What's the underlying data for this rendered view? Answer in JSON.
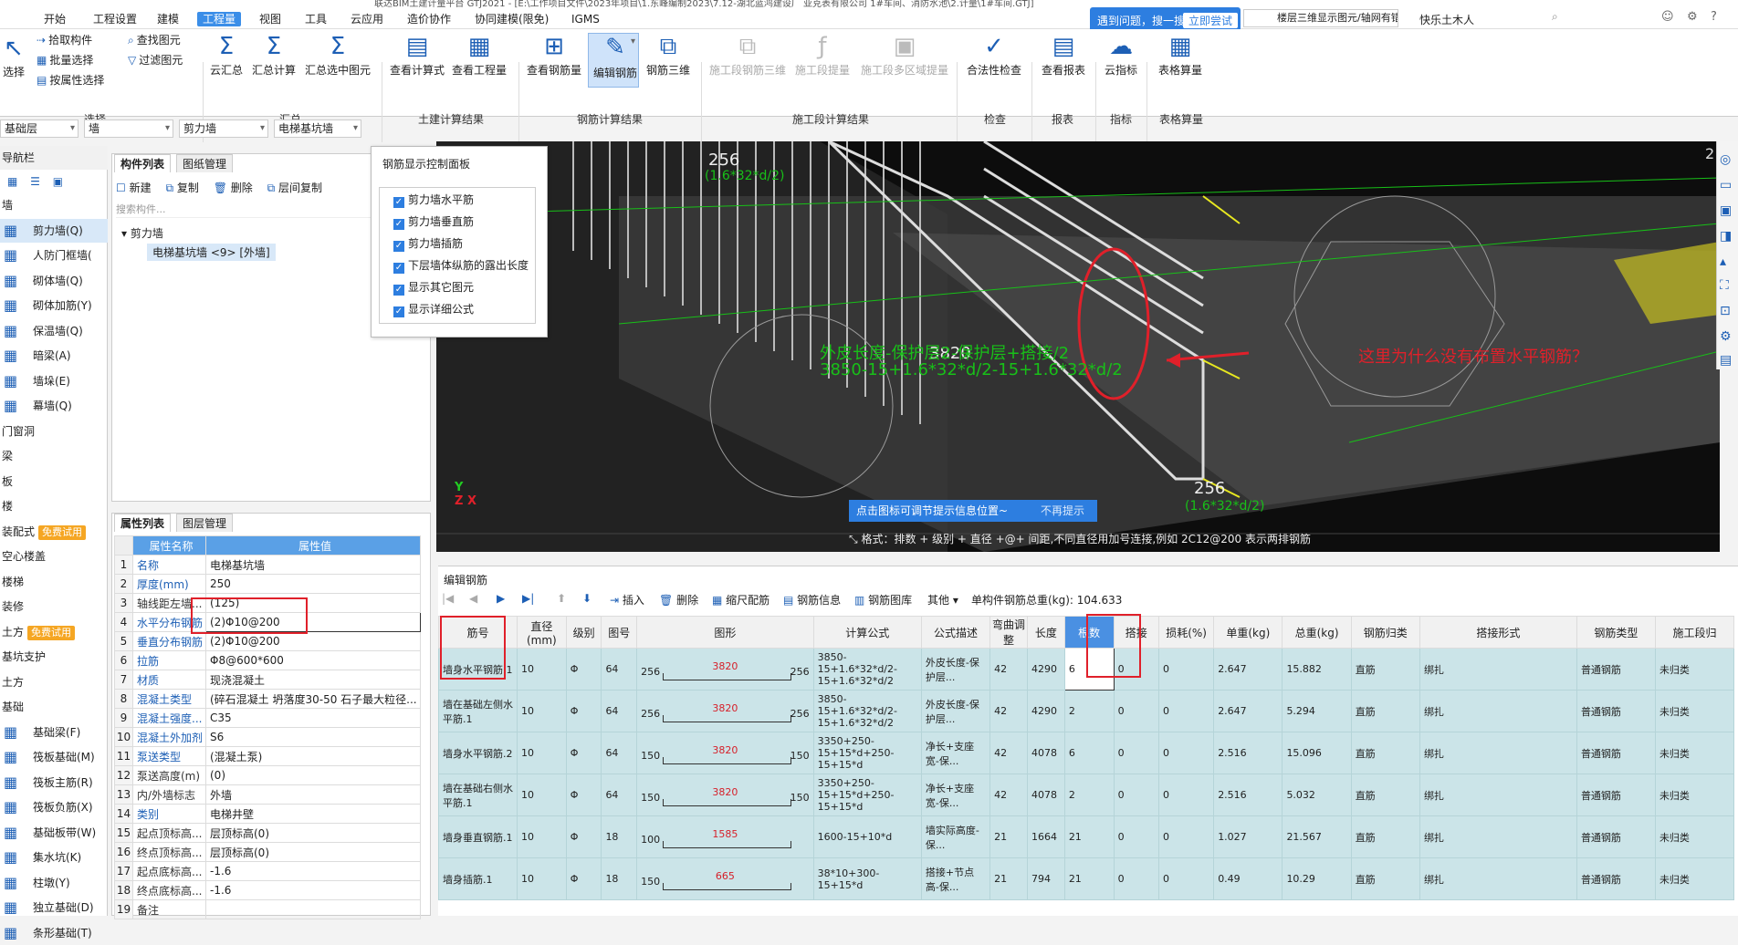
{
  "title": "联达BIM土建计量平台 GTJ2021 - [E:\\工作项目文件\\2023年项目\\1.东峰编制2023\\7.12-湖北蓝鸿建设厂 亚克表有限公司 1#车间、消防水池\\2.计量\\1#车间.GTJ]",
  "menu": [
    "开始",
    "工程设置",
    "建模",
    "工程量",
    "视图",
    "工具",
    "云应用",
    "造价协作",
    "协同建模(限免)",
    "IGMS"
  ],
  "help": {
    "label": "遇到问题，搜一搜",
    "try": "立即尝试",
    "search": "楼层三维显示图元/轴网有错位，位置不对应如何处理?",
    "user": "快乐土木人"
  },
  "ribbon": {
    "select": {
      "big": "选择",
      "items": [
        "拾取构件",
        "批量选择",
        "按属性选择"
      ],
      "group": "选择"
    },
    "summary": {
      "items": [
        "云汇总",
        "汇总计算",
        "汇总选中图元"
      ],
      "small": [
        "查找图元",
        "过滤图元"
      ],
      "group": "汇总"
    },
    "civil": {
      "items": [
        "查看计算式",
        "查看工程量"
      ],
      "group": "土建计算结果"
    },
    "rebar": {
      "items": [
        "查看钢筋量",
        "编辑钢筋",
        "钢筋三维"
      ],
      "group": "钢筋计算结果"
    },
    "stage": {
      "items": [
        "施工段钢筋三维",
        "施工段提量",
        "施工段多区域提量"
      ],
      "group": "施工段计算结果"
    },
    "check": {
      "items": [
        "合法性检查"
      ],
      "group": "检查"
    },
    "report": {
      "items": [
        "查看报表"
      ],
      "group": "报表"
    },
    "index": {
      "items": [
        "云指标"
      ],
      "group": "指标"
    },
    "table": {
      "items": [
        "表格算量"
      ],
      "group": "表格算量"
    }
  },
  "selects": [
    "基础层",
    "墙",
    "剪力墙",
    "电梯基坑墙"
  ],
  "nav": {
    "header": "导航栏",
    "items": [
      {
        "label": "墙"
      },
      {
        "label": "剪力墙(Q)",
        "sub": true,
        "active": true
      },
      {
        "label": "人防门框墙(",
        "sub": true
      },
      {
        "label": "砌体墙(Q)",
        "sub": true
      },
      {
        "label": "砌体加筋(Y)",
        "sub": true
      },
      {
        "label": "保温墙(Q)",
        "sub": true
      },
      {
        "label": "暗梁(A)",
        "sub": true
      },
      {
        "label": "墙垛(E)",
        "sub": true
      },
      {
        "label": "幕墙(Q)",
        "sub": true
      },
      {
        "label": "门窗洞"
      },
      {
        "label": "梁"
      },
      {
        "label": "板"
      },
      {
        "label": "楼"
      },
      {
        "label": "装配式",
        "badge": "免费试用"
      },
      {
        "label": "空心楼盖"
      },
      {
        "label": "楼梯"
      },
      {
        "label": "装修"
      },
      {
        "label": "土方",
        "badge": "免费试用"
      },
      {
        "label": "基坑支护"
      },
      {
        "label": "土方"
      },
      {
        "label": "基础"
      },
      {
        "label": "基础梁(F)",
        "sub": true
      },
      {
        "label": "筏板基础(M)",
        "sub": true
      },
      {
        "label": "筏板主筋(R)",
        "sub": true
      },
      {
        "label": "筏板负筋(X)",
        "sub": true
      },
      {
        "label": "基础板带(W)",
        "sub": true
      },
      {
        "label": "集水坑(K)",
        "sub": true
      },
      {
        "label": "柱墩(Y)",
        "sub": true
      },
      {
        "label": "独立基础(D)",
        "sub": true
      },
      {
        "label": "条形基础(T)",
        "sub": true
      }
    ]
  },
  "comp": {
    "tabs": [
      "构件列表",
      "图纸管理"
    ],
    "actions": [
      "新建",
      "复制",
      "删除",
      "层间复制"
    ],
    "search": "搜索构件...",
    "tree_root": "剪力墙",
    "tree_item": "电梯基坑墙 <9> [外墙]"
  },
  "prop": {
    "tabs": [
      "属性列表",
      "图层管理"
    ],
    "headers": [
      "属性名称",
      "属性值"
    ],
    "rows": [
      {
        "n": "1",
        "k": "名称",
        "v": "电梯基坑墙"
      },
      {
        "n": "2",
        "k": "厚度(mm)",
        "v": "250"
      },
      {
        "n": "3",
        "k": "轴线距左墙...",
        "v": "(125)",
        "g": true
      },
      {
        "n": "4",
        "k": "水平分布钢筋",
        "v": "(2)Φ10@200"
      },
      {
        "n": "5",
        "k": "垂直分布钢筋",
        "v": "(2)Φ10@200"
      },
      {
        "n": "6",
        "k": "拉筋",
        "v": "Φ8@600*600"
      },
      {
        "n": "7",
        "k": "材质",
        "v": "现浇混凝土"
      },
      {
        "n": "8",
        "k": "混凝土类型",
        "v": "(碎石混凝土 坍落度30-50 石子最大粒径..."
      },
      {
        "n": "9",
        "k": "混凝土强度...",
        "v": "C35"
      },
      {
        "n": "10",
        "k": "混凝土外加剂",
        "v": "S6"
      },
      {
        "n": "11",
        "k": "泵送类型",
        "v": "(混凝土泵)"
      },
      {
        "n": "12",
        "k": "泵送高度(m)",
        "v": "(0)",
        "g": true
      },
      {
        "n": "13",
        "k": "内/外墙标志",
        "v": "外墙",
        "g": true
      },
      {
        "n": "14",
        "k": "类别",
        "v": "电梯井壁"
      },
      {
        "n": "15",
        "k": "起点顶标高...",
        "v": "层顶标高(0)",
        "g": true
      },
      {
        "n": "16",
        "k": "终点顶标高...",
        "v": "层顶标高(0)",
        "g": true
      },
      {
        "n": "17",
        "k": "起点底标高...",
        "v": "-1.6",
        "g": true
      },
      {
        "n": "18",
        "k": "终点底标高...",
        "v": "-1.6",
        "g": true
      },
      {
        "n": "19",
        "k": "备注",
        "v": "",
        "g": true
      }
    ]
  },
  "rebar_panel": {
    "title": "钢筋显示控制面板",
    "items": [
      "剪力墙水平筋",
      "剪力墙垂直筋",
      "剪力墙插筋",
      "下层墙体纵筋的露出长度",
      "显示其它图元",
      "显示详细公式"
    ]
  },
  "view": {
    "labels": [
      "256",
      "256",
      "3820",
      "2"
    ],
    "formula1": "外皮长度-保护层2-保护层+搭接/2",
    "formula2": "3850-15+1.6*32*d/2-15+1.6*32*d/2",
    "formula_side": "(1.6*32*d/2)",
    "question": "这里为什么没有布置水平钢筋？",
    "hint": "点击图标可调节提示信息位置~",
    "hint_off": "不再提示",
    "format": "格式：排数 + 级别 + 直径 +@+ 间距,不同直径用加号连接,例如 2C12@200 表示两排钢筋"
  },
  "edit": {
    "title": "编辑钢筋",
    "toolbar": [
      "插入",
      "删除",
      "缩尺配筋",
      "钢筋信息",
      "钢筋图库",
      "其他"
    ],
    "total": "单构件钢筋总重(kg): 104.633",
    "headers": [
      "筋号",
      "直径(mm)",
      "级别",
      "图号",
      "图形",
      "计算公式",
      "公式描述",
      "弯曲调整",
      "长度",
      "根数",
      "搭接",
      "损耗(%)",
      "单重(kg)",
      "总重(kg)",
      "钢筋归类",
      "搭接形式",
      "钢筋类型",
      "施工段归"
    ],
    "rows": [
      {
        "idx": "1",
        "name": "墙身水平钢筋.1",
        "dia": "10",
        "grade": "Φ",
        "fig": "64",
        "l": "256",
        "m": "3820",
        "r": "256",
        "formula": "3850-15+1.6*32*d/2-15+1.6*32*d/2",
        "desc": "外皮长度-保护层...",
        "adj": "42",
        "len": "4290",
        "cnt": "6",
        "lap": "0",
        "loss": "0",
        "unit": "2.647",
        "total": "15.882",
        "cat": "直筋",
        "lapf": "绑扎",
        "type": "普通钢筋",
        "stage": "未归类"
      },
      {
        "idx": "2",
        "name": "墙在基础左侧水平筋.1",
        "dia": "10",
        "grade": "Φ",
        "fig": "64",
        "l": "256",
        "m": "3820",
        "r": "256",
        "formula": "3850-15+1.6*32*d/2-15+1.6*32*d/2",
        "desc": "外皮长度-保护层...",
        "adj": "42",
        "len": "4290",
        "cnt": "2",
        "lap": "0",
        "loss": "0",
        "unit": "2.647",
        "total": "5.294",
        "cat": "直筋",
        "lapf": "绑扎",
        "type": "普通钢筋",
        "stage": "未归类"
      },
      {
        "idx": "3",
        "name": "墙身水平钢筋.2",
        "dia": "10",
        "grade": "Φ",
        "fig": "64",
        "l": "150",
        "m": "3820",
        "r": "150",
        "formula": "3350+250-15+15*d+250-15+15*d",
        "desc": "净长+支座宽-保...",
        "adj": "42",
        "len": "4078",
        "cnt": "6",
        "lap": "0",
        "loss": "0",
        "unit": "2.516",
        "total": "15.096",
        "cat": "直筋",
        "lapf": "绑扎",
        "type": "普通钢筋",
        "stage": "未归类"
      },
      {
        "idx": "4",
        "name": "墙在基础右侧水平筋.1",
        "dia": "10",
        "grade": "Φ",
        "fig": "64",
        "l": "150",
        "m": "3820",
        "r": "150",
        "formula": "3350+250-15+15*d+250-15+15*d",
        "desc": "净长+支座宽-保...",
        "adj": "42",
        "len": "4078",
        "cnt": "2",
        "lap": "0",
        "loss": "0",
        "unit": "2.516",
        "total": "5.032",
        "cat": "直筋",
        "lapf": "绑扎",
        "type": "普通钢筋",
        "stage": "未归类"
      },
      {
        "idx": "5",
        "name": "墙身垂直钢筋.1",
        "dia": "10",
        "grade": "Φ",
        "fig": "18",
        "l": "100",
        "m": "1585",
        "r": "",
        "formula": "1600-15+10*d",
        "desc": "墙实际高度-保...",
        "adj": "21",
        "len": "1664",
        "cnt": "21",
        "lap": "0",
        "loss": "0",
        "unit": "1.027",
        "total": "21.567",
        "cat": "直筋",
        "lapf": "绑扎",
        "type": "普通钢筋",
        "stage": "未归类"
      },
      {
        "idx": "6",
        "name": "墙身插筋.1",
        "dia": "10",
        "grade": "Φ",
        "fig": "18",
        "l": "150",
        "m": "665",
        "r": "",
        "formula": "38*10+300-15+15*d",
        "desc": "搭接+节点高-保...",
        "adj": "21",
        "len": "794",
        "cnt": "21",
        "lap": "0",
        "loss": "0",
        "unit": "0.49",
        "total": "10.29",
        "cat": "直筋",
        "lapf": "绑扎",
        "type": "普通钢筋",
        "stage": "未归类"
      }
    ]
  }
}
